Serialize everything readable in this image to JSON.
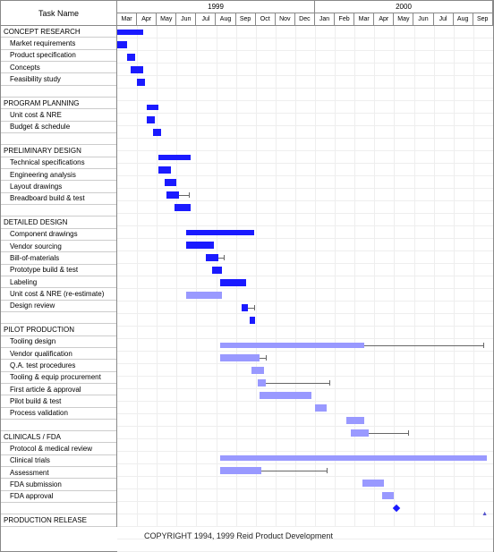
{
  "header": {
    "task_col": "Task Name",
    "years": [
      {
        "label": "1999",
        "span": 10
      },
      {
        "label": "2000",
        "span": 9
      }
    ],
    "months": [
      "Mar",
      "Apr",
      "May",
      "Jun",
      "Jul",
      "Aug",
      "Sep",
      "Oct",
      "Nov",
      "Dec",
      "Jan",
      "Feb",
      "Mar",
      "Apr",
      "May",
      "Jun",
      "Jul",
      "Aug",
      "Sep"
    ]
  },
  "copyright": "COPYRIGHT 1994, 1999  Reid Product Development",
  "chart_data": {
    "type": "gantt",
    "title": "",
    "xlabel": "",
    "ylabel": "",
    "time_axis": {
      "start": "1999-03",
      "end": "2000-09",
      "unit": "month"
    },
    "rows": [
      {
        "name": "CONCEPT RESEARCH",
        "kind": "group",
        "bar": {
          "style": "summary",
          "start": 0,
          "dur": 1.3
        }
      },
      {
        "name": "Market requirements",
        "kind": "sub",
        "bar": {
          "style": "solid",
          "start": 0,
          "dur": 0.5
        }
      },
      {
        "name": "Product specification",
        "kind": "sub",
        "bar": {
          "style": "solid",
          "start": 0.5,
          "dur": 0.4
        }
      },
      {
        "name": "Concepts",
        "kind": "sub",
        "bar": {
          "style": "solid",
          "start": 0.7,
          "dur": 0.6
        }
      },
      {
        "name": "Feasibility study",
        "kind": "sub",
        "bar": {
          "style": "solid",
          "start": 1.0,
          "dur": 0.4
        }
      },
      {
        "name": "",
        "kind": "empty"
      },
      {
        "name": "PROGRAM PLANNING",
        "kind": "group",
        "bar": {
          "style": "summary",
          "start": 1.5,
          "dur": 0.6
        }
      },
      {
        "name": "Unit cost & NRE",
        "kind": "sub",
        "bar": {
          "style": "solid",
          "start": 1.5,
          "dur": 0.4
        }
      },
      {
        "name": "Budget & schedule",
        "kind": "sub",
        "bar": {
          "style": "solid",
          "start": 1.8,
          "dur": 0.4
        }
      },
      {
        "name": "",
        "kind": "empty"
      },
      {
        "name": "PRELIMINARY DESIGN",
        "kind": "group",
        "bar": {
          "style": "summary",
          "start": 2.1,
          "dur": 1.6
        }
      },
      {
        "name": "Technical specifications",
        "kind": "sub",
        "bar": {
          "style": "solid",
          "start": 2.1,
          "dur": 0.6
        }
      },
      {
        "name": "Engineering analysis",
        "kind": "sub",
        "bar": {
          "style": "solid",
          "start": 2.4,
          "dur": 0.6
        }
      },
      {
        "name": "Layout drawings",
        "kind": "sub",
        "bar": {
          "style": "solid",
          "start": 2.5,
          "dur": 0.6
        },
        "trail": {
          "start": 3.1,
          "dur": 0.5
        }
      },
      {
        "name": "Breadboard build & test",
        "kind": "sub",
        "bar": {
          "style": "solid",
          "start": 2.9,
          "dur": 0.8
        }
      },
      {
        "name": "",
        "kind": "empty"
      },
      {
        "name": "DETAILED DESIGN",
        "kind": "group",
        "bar": {
          "style": "summary",
          "start": 3.5,
          "dur": 3.4
        }
      },
      {
        "name": "Component drawings",
        "kind": "sub",
        "bar": {
          "style": "solid",
          "start": 3.5,
          "dur": 1.4
        }
      },
      {
        "name": "Vendor sourcing",
        "kind": "sub",
        "bar": {
          "style": "solid",
          "start": 4.5,
          "dur": 0.6
        },
        "trail": {
          "start": 5.1,
          "dur": 0.3
        }
      },
      {
        "name": "Bill-of-materials",
        "kind": "sub",
        "bar": {
          "style": "solid",
          "start": 4.8,
          "dur": 0.5
        }
      },
      {
        "name": "Prototype build & test",
        "kind": "sub",
        "bar": {
          "style": "solid",
          "start": 5.2,
          "dur": 1.3
        }
      },
      {
        "name": "Labeling",
        "kind": "sub",
        "bar": {
          "style": "light",
          "start": 3.5,
          "dur": 1.8
        }
      },
      {
        "name": "Unit cost & NRE (re-estimate)",
        "kind": "sub",
        "bar": {
          "style": "solid",
          "start": 6.3,
          "dur": 0.3
        },
        "trail": {
          "start": 6.6,
          "dur": 0.3
        }
      },
      {
        "name": "Design review",
        "kind": "sub",
        "bar": {
          "style": "solid",
          "start": 6.7,
          "dur": 0.25
        }
      },
      {
        "name": "",
        "kind": "empty"
      },
      {
        "name": "PILOT PRODUCTION",
        "kind": "group",
        "bar": {
          "style": "lsummary",
          "start": 5.2,
          "dur": 7.3
        },
        "trail": {
          "start": 12.5,
          "dur": 6.0
        }
      },
      {
        "name": "Tooling design",
        "kind": "sub",
        "bar": {
          "style": "light",
          "start": 5.2,
          "dur": 2.0
        },
        "trail": {
          "start": 7.2,
          "dur": 0.3
        }
      },
      {
        "name": "Vendor qualification",
        "kind": "sub",
        "bar": {
          "style": "light",
          "start": 6.8,
          "dur": 0.6
        }
      },
      {
        "name": "Q.A. test procedures",
        "kind": "sub",
        "bar": {
          "style": "light",
          "start": 7.1,
          "dur": 0.4
        },
        "trail": {
          "start": 7.5,
          "dur": 3.2
        }
      },
      {
        "name": "Tooling & equip procurement",
        "kind": "sub",
        "bar": {
          "style": "light",
          "start": 7.2,
          "dur": 2.6
        }
      },
      {
        "name": "First article & approval",
        "kind": "sub",
        "bar": {
          "style": "light",
          "start": 10.0,
          "dur": 0.6
        }
      },
      {
        "name": "Pilot build & test",
        "kind": "sub",
        "bar": {
          "style": "light",
          "start": 11.6,
          "dur": 0.9
        }
      },
      {
        "name": "Process validation",
        "kind": "sub",
        "bar": {
          "style": "light",
          "start": 11.8,
          "dur": 0.9
        },
        "trail": {
          "start": 12.7,
          "dur": 2.0
        }
      },
      {
        "name": "",
        "kind": "empty"
      },
      {
        "name": "CLINICALS / FDA",
        "kind": "group",
        "bar": {
          "style": "lsummary",
          "start": 5.2,
          "dur": 13.5
        }
      },
      {
        "name": "Protocol & medical review",
        "kind": "sub",
        "bar": {
          "style": "light",
          "start": 5.2,
          "dur": 2.1
        },
        "trail": {
          "start": 7.3,
          "dur": 3.3
        }
      },
      {
        "name": "Clinical trials",
        "kind": "sub",
        "bar": {
          "style": "light",
          "start": 12.4,
          "dur": 1.1
        }
      },
      {
        "name": "Assessment",
        "kind": "sub",
        "bar": {
          "style": "light",
          "start": 13.4,
          "dur": 0.6
        }
      },
      {
        "name": "FDA submission",
        "kind": "sub",
        "milestone": {
          "at": 14.1
        }
      },
      {
        "name": "FDA approval",
        "kind": "sub"
      },
      {
        "name": "",
        "kind": "empty"
      },
      {
        "name": "PRODUCTION RELEASE",
        "kind": "group"
      }
    ]
  }
}
